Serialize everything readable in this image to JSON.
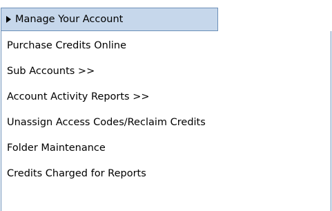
{
  "menu": {
    "header_label": "Manage Your Account",
    "items": [
      {
        "label": "Purchase Credits Online"
      },
      {
        "label": "Sub Accounts >>"
      },
      {
        "label": "Account Activity Reports >>"
      },
      {
        "label": "Unassign Access Codes/Reclaim Credits"
      },
      {
        "label": "Folder Maintenance"
      },
      {
        "label": "Credits Charged for Reports"
      }
    ]
  },
  "colors": {
    "header_background": "#c6d7eb",
    "border": "#6b8fb8",
    "text": "#000000"
  },
  "icons": {
    "header_indicator": "caret-right-icon"
  }
}
